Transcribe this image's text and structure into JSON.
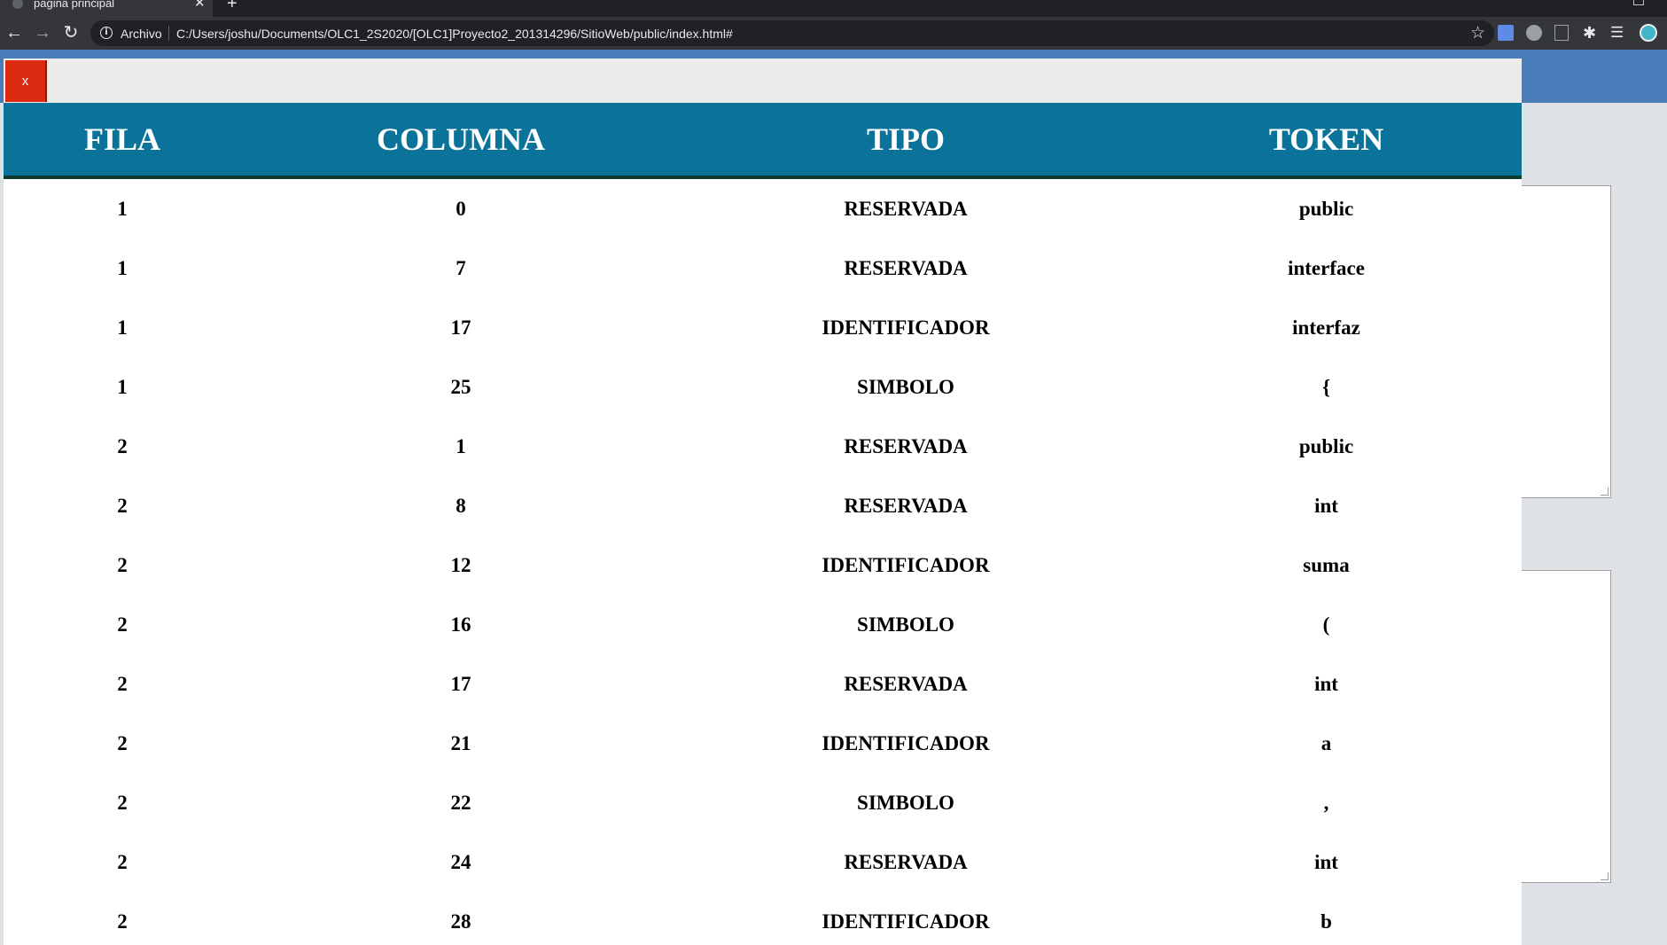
{
  "browser": {
    "tab_title": "pagina principal",
    "scheme_label": "Archivo",
    "url": "C:/Users/joshu/Documents/OLC1_2S2020/[OLC1]Proyecto2_201314296/SitioWeb/public/index.html#",
    "icons": [
      "back-icon",
      "forward-icon",
      "reload-icon",
      "info-icon",
      "star-icon",
      "translate-icon",
      "extension-icon",
      "pdf-icon",
      "puzzle-icon",
      "reading-list-icon",
      "avatar-icon"
    ]
  },
  "modal": {
    "close_label": "x",
    "close_color": "#dc2a10",
    "header_color": "#0b739a"
  },
  "table": {
    "headers": [
      "FILA",
      "COLUMNA",
      "TIPO",
      "TOKEN"
    ],
    "rows": [
      [
        "1",
        "0",
        "RESERVADA",
        "public"
      ],
      [
        "1",
        "7",
        "RESERVADA",
        "interface"
      ],
      [
        "1",
        "17",
        "IDENTIFICADOR",
        "interfaz"
      ],
      [
        "1",
        "25",
        "SIMBOLO",
        "{"
      ],
      [
        "2",
        "1",
        "RESERVADA",
        "public"
      ],
      [
        "2",
        "8",
        "RESERVADA",
        "int"
      ],
      [
        "2",
        "12",
        "IDENTIFICADOR",
        "suma"
      ],
      [
        "2",
        "16",
        "SIMBOLO",
        "("
      ],
      [
        "2",
        "17",
        "RESERVADA",
        "int"
      ],
      [
        "2",
        "21",
        "IDENTIFICADOR",
        "a"
      ],
      [
        "2",
        "22",
        "SIMBOLO",
        ","
      ],
      [
        "2",
        "24",
        "RESERVADA",
        "int"
      ],
      [
        "2",
        "28",
        "IDENTIFICADOR",
        "b"
      ]
    ]
  }
}
